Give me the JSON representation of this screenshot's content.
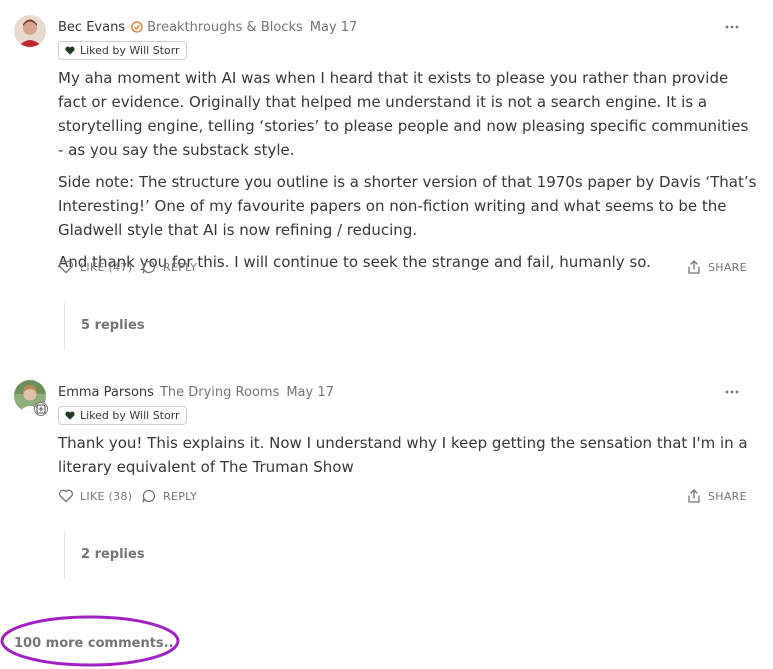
{
  "comments": [
    {
      "author": "Bec Evans",
      "publication": "Breakthroughs & Blocks",
      "date": "May 17",
      "liked_by": "Liked by Will Storr",
      "paragraphs": [
        "My aha moment with AI was when I heard that it exists to please you rather than provide fact or evidence. Originally that helped me understand it is not a search engine. It is a storytelling engine, telling ‘stories’ to please people and now pleasing specific communities - as you say the substack style.",
        "Side note: The structure you outline is a shorter version of that 1970s paper by Davis ‘That’s Interesting!’ One of my favourite papers on non-fiction writing and what seems to be the Gladwell style that AI is now refining / reducing.",
        "And thank you for this. I will continue to seek the strange and fail, humanly so."
      ],
      "like_label": "LIKE (47)",
      "reply_label": "REPLY",
      "share_label": "SHARE",
      "replies_label": "5 replies"
    },
    {
      "author": "Emma Parsons",
      "publication": "The Drying Rooms",
      "date": "May 17",
      "liked_by": "Liked by Will Storr",
      "paragraphs": [
        "Thank you! This explains it. Now I understand why I keep getting the sensation that I'm in a literary equivalent of The Truman Show"
      ],
      "like_label": "LIKE (38)",
      "reply_label": "REPLY",
      "share_label": "SHARE",
      "replies_label": "2 replies"
    }
  ],
  "more_comments": "100 more comments...",
  "colors": {
    "text": "#363737",
    "muted": "#757575",
    "verified": "#e8792b",
    "annotation": "#a321c4"
  },
  "icons": [
    "verified-icon",
    "heart-icon",
    "comment-icon",
    "share-icon",
    "more-dots-icon",
    "plus-badge-icon"
  ]
}
